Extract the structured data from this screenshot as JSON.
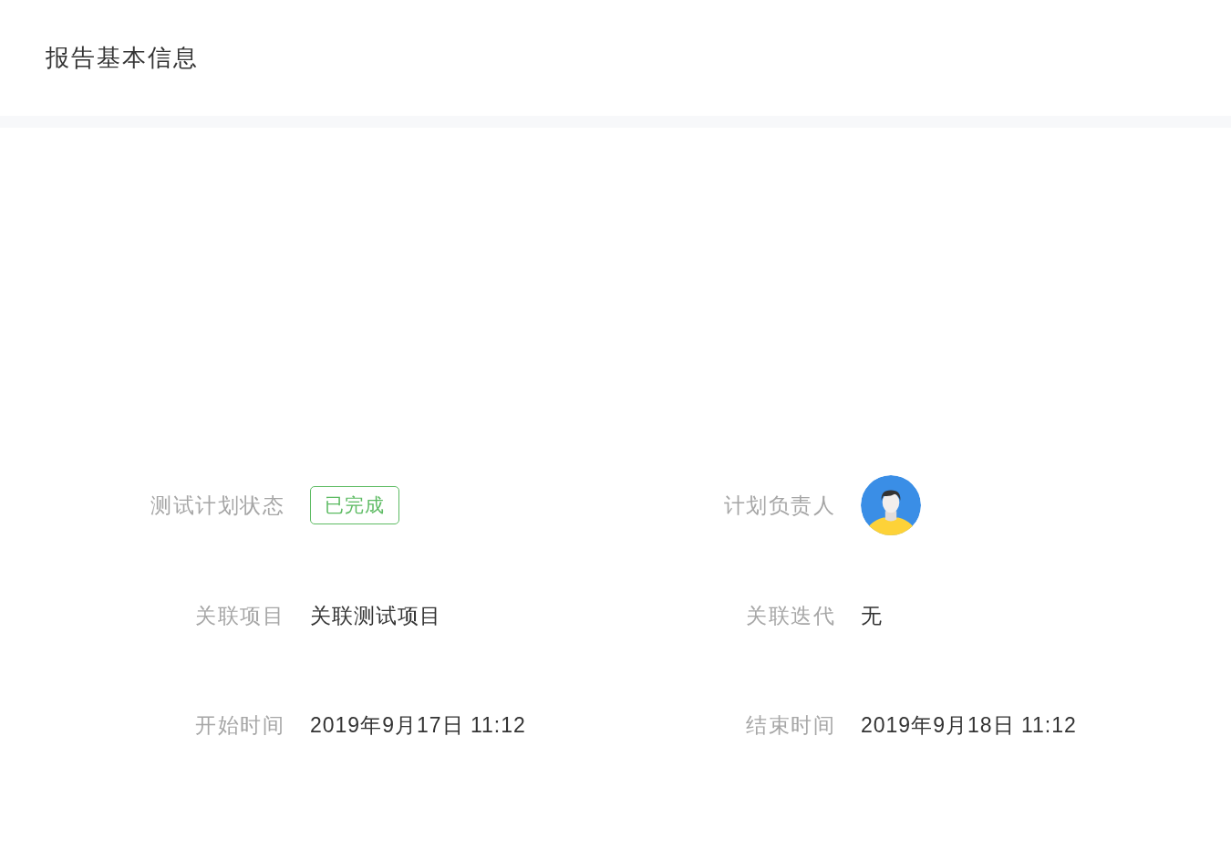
{
  "header": {
    "title": "报告基本信息"
  },
  "fields": [
    {
      "kind": "status",
      "label": "测试计划状态",
      "value": "已完成"
    },
    {
      "kind": "avatar",
      "label": "计划负责人"
    },
    {
      "kind": "text",
      "label": "关联项目",
      "value": "关联测试项目"
    },
    {
      "kind": "text",
      "label": "关联迭代",
      "value": "无"
    },
    {
      "kind": "text",
      "label": "开始时间",
      "value": "2019年9月17日 11:12"
    },
    {
      "kind": "text",
      "label": "结束时间",
      "value": "2019年9月18日 11:12"
    }
  ]
}
